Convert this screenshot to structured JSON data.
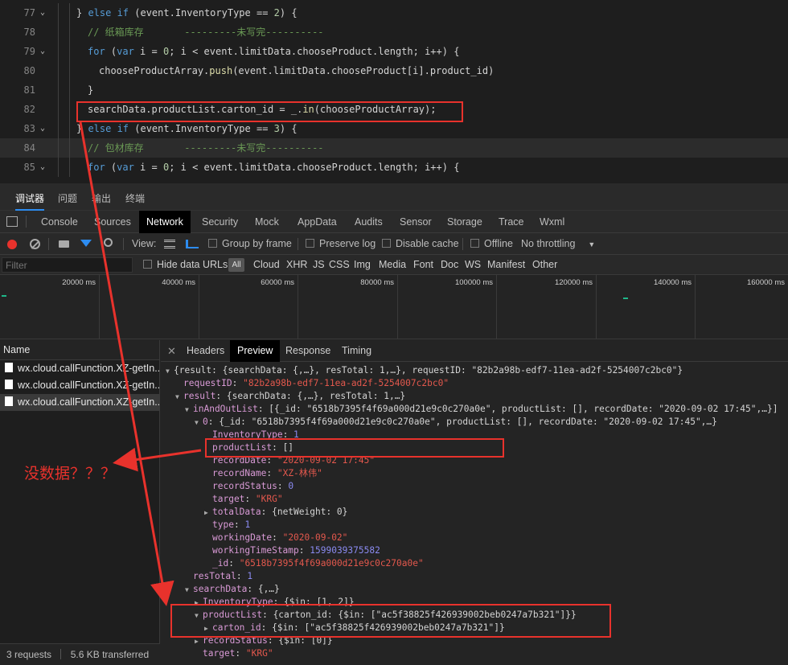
{
  "editor": {
    "lines": [
      {
        "num": "77",
        "fold": "⌄",
        "indent": 95,
        "tokens": [
          [
            "pl",
            "} "
          ],
          [
            "kw",
            "else if"
          ],
          [
            "pl",
            " (event.InventoryType == "
          ],
          [
            "num",
            "2"
          ],
          [
            "pl",
            ") {"
          ]
        ]
      },
      {
        "num": "78",
        "fold": "",
        "indent": 109,
        "tokens": [
          [
            "cm",
            "// 纸箱库存       ---------未写完----------"
          ]
        ]
      },
      {
        "num": "79",
        "fold": "⌄",
        "indent": 109,
        "tokens": [
          [
            "kw",
            "for"
          ],
          [
            "pl",
            " ("
          ],
          [
            "kw",
            "var"
          ],
          [
            "pl",
            " i = "
          ],
          [
            "num",
            "0"
          ],
          [
            "pl",
            "; i < event.limitData.chooseProduct.length; i++) {"
          ]
        ]
      },
      {
        "num": "80",
        "fold": "",
        "indent": 123,
        "tokens": [
          [
            "pl",
            "chooseProductArray."
          ],
          [
            "fn",
            "push"
          ],
          [
            "pl",
            "(event.limitData.chooseProduct[i].product_id)"
          ]
        ]
      },
      {
        "num": "81",
        "fold": "",
        "indent": 109,
        "tokens": [
          [
            "pl",
            "}"
          ]
        ]
      },
      {
        "num": "82",
        "fold": "",
        "indent": 109,
        "tokens": [
          [
            "pl",
            "searchData.productList.carton_id = _."
          ],
          [
            "fn",
            "in"
          ],
          [
            "pl",
            "(chooseProductArray);"
          ]
        ]
      },
      {
        "num": "83",
        "fold": "⌄",
        "indent": 95,
        "tokens": [
          [
            "pl",
            "} "
          ],
          [
            "kw",
            "else if"
          ],
          [
            "pl",
            " (event.InventoryType == "
          ],
          [
            "num",
            "3"
          ],
          [
            "pl",
            ") {"
          ]
        ]
      },
      {
        "num": "84",
        "fold": "",
        "indent": 109,
        "tokens": [
          [
            "cm",
            "// 包材库存       ---------未写完----------"
          ]
        ]
      },
      {
        "num": "85",
        "fold": "⌄",
        "indent": 109,
        "tokens": [
          [
            "kw",
            "for"
          ],
          [
            "pl",
            " ("
          ],
          [
            "kw",
            "var"
          ],
          [
            "pl",
            " i = "
          ],
          [
            "num",
            "0"
          ],
          [
            "pl",
            "; i < event.limitData.chooseProduct.length; i++) {"
          ]
        ]
      }
    ]
  },
  "devtools": {
    "top_tabs": [
      "调试器",
      "问题",
      "输出",
      "终端"
    ],
    "panel_tabs": [
      "Console",
      "Sources",
      "Network",
      "Security",
      "Mock",
      "AppData",
      "Audits",
      "Sensor",
      "Storage",
      "Trace",
      "Wxml"
    ],
    "toolbar": {
      "view_label": "View:",
      "group_by_frame": "Group by frame",
      "preserve_log": "Preserve log",
      "disable_cache": "Disable cache",
      "offline": "Offline",
      "throttling": "No throttling"
    },
    "filter": {
      "placeholder": "Filter",
      "hide_data_urls": "Hide data URLs",
      "all": "All",
      "types": [
        "Cloud",
        "XHR",
        "JS",
        "CSS",
        "Img",
        "Media",
        "Font",
        "Doc",
        "WS",
        "Manifest",
        "Other"
      ]
    },
    "timeline_labels": [
      "20000 ms",
      "40000 ms",
      "60000 ms",
      "80000 ms",
      "100000 ms",
      "120000 ms",
      "140000 ms",
      "160000 ms"
    ],
    "name_header": "Name",
    "requests": [
      "wx.cloud.callFunction.XZ-getIn...",
      "wx.cloud.callFunction.XZ-getIn...",
      "wx.cloud.callFunction.XZ-getIn..."
    ],
    "status": {
      "requests": "3 requests",
      "transferred": "5.6 KB transferred"
    },
    "detail_tabs": [
      "Headers",
      "Preview",
      "Response",
      "Timing"
    ],
    "preview_lines": [
      {
        "indent": 0,
        "tri": "▼",
        "parts": [
          [
            "dim",
            "{result: {searchData: {,…}, resTotal: 1,…}, requestID: \"82b2a98b-edf7-11ea-ad2f-5254007c2bc0\"}"
          ]
        ]
      },
      {
        "indent": 1,
        "tri": "",
        "parts": [
          [
            "k",
            "requestID"
          ],
          [
            "dim",
            ": "
          ],
          [
            "s",
            "\"82b2a98b-edf7-11ea-ad2f-5254007c2bc0\""
          ]
        ]
      },
      {
        "indent": 1,
        "tri": "▼",
        "parts": [
          [
            "k",
            "result"
          ],
          [
            "dim",
            ": {searchData: {,…}, resTotal: 1,…}"
          ]
        ]
      },
      {
        "indent": 2,
        "tri": "▼",
        "parts": [
          [
            "k",
            "inAndOutList"
          ],
          [
            "dim",
            ": [{_id: \"6518b7395f4f69a000d21e9c0c270a0e\", productList: [], recordDate: \"2020-09-02 17:45\",…}]"
          ]
        ]
      },
      {
        "indent": 3,
        "tri": "▼",
        "parts": [
          [
            "k",
            "0"
          ],
          [
            "dim",
            ": {_id: \"6518b7395f4f69a000d21e9c0c270a0e\", productList: [], recordDate: \"2020-09-02 17:45\",…}"
          ]
        ]
      },
      {
        "indent": 4,
        "tri": "",
        "parts": [
          [
            "k",
            "InventoryType"
          ],
          [
            "dim",
            ": "
          ],
          [
            "n",
            "1"
          ]
        ]
      },
      {
        "indent": 4,
        "tri": "",
        "parts": [
          [
            "k",
            "productList"
          ],
          [
            "dim",
            ": []"
          ]
        ]
      },
      {
        "indent": 4,
        "tri": "",
        "parts": [
          [
            "k",
            "recordDate"
          ],
          [
            "dim",
            ": "
          ],
          [
            "s",
            "\"2020-09-02 17:45\""
          ]
        ]
      },
      {
        "indent": 4,
        "tri": "",
        "parts": [
          [
            "k",
            "recordName"
          ],
          [
            "dim",
            ": "
          ],
          [
            "s",
            "\"XZ-林伟\""
          ]
        ]
      },
      {
        "indent": 4,
        "tri": "",
        "parts": [
          [
            "k",
            "recordStatus"
          ],
          [
            "dim",
            ": "
          ],
          [
            "n",
            "0"
          ]
        ]
      },
      {
        "indent": 4,
        "tri": "",
        "parts": [
          [
            "k",
            "target"
          ],
          [
            "dim",
            ": "
          ],
          [
            "s",
            "\"KRG\""
          ]
        ]
      },
      {
        "indent": 4,
        "tri": "▶",
        "parts": [
          [
            "k",
            "totalData"
          ],
          [
            "dim",
            ": {netWeight: 0}"
          ]
        ]
      },
      {
        "indent": 4,
        "tri": "",
        "parts": [
          [
            "k",
            "type"
          ],
          [
            "dim",
            ": "
          ],
          [
            "n",
            "1"
          ]
        ]
      },
      {
        "indent": 4,
        "tri": "",
        "parts": [
          [
            "k",
            "workingDate"
          ],
          [
            "dim",
            ": "
          ],
          [
            "s",
            "\"2020-09-02\""
          ]
        ]
      },
      {
        "indent": 4,
        "tri": "",
        "parts": [
          [
            "k",
            "workingTimeStamp"
          ],
          [
            "dim",
            ": "
          ],
          [
            "n",
            "1599039375582"
          ]
        ]
      },
      {
        "indent": 4,
        "tri": "",
        "parts": [
          [
            "k",
            "_id"
          ],
          [
            "dim",
            ": "
          ],
          [
            "s",
            "\"6518b7395f4f69a000d21e9c0c270a0e\""
          ]
        ]
      },
      {
        "indent": 2,
        "tri": "",
        "parts": [
          [
            "k",
            "resTotal"
          ],
          [
            "dim",
            ": "
          ],
          [
            "n",
            "1"
          ]
        ]
      },
      {
        "indent": 2,
        "tri": "▼",
        "parts": [
          [
            "k",
            "searchData"
          ],
          [
            "dim",
            ": {,…}"
          ]
        ]
      },
      {
        "indent": 3,
        "tri": "▶",
        "parts": [
          [
            "k",
            "InventoryType"
          ],
          [
            "dim",
            ": {$in: [1, 2]}"
          ]
        ]
      },
      {
        "indent": 3,
        "tri": "▼",
        "parts": [
          [
            "k",
            "productList"
          ],
          [
            "dim",
            ": {carton_id: {$in: [\"ac5f38825f426939002beb0247a7b321\"]}}"
          ]
        ]
      },
      {
        "indent": 4,
        "tri": "▶",
        "parts": [
          [
            "k",
            "carton_id"
          ],
          [
            "dim",
            ": {$in: [\"ac5f38825f426939002beb0247a7b321\"]}"
          ]
        ]
      },
      {
        "indent": 3,
        "tri": "▶",
        "parts": [
          [
            "k",
            "recordStatus"
          ],
          [
            "dim",
            ": {$in: [0]}"
          ]
        ]
      },
      {
        "indent": 3,
        "tri": "",
        "parts": [
          [
            "k",
            "target"
          ],
          [
            "dim",
            ": "
          ],
          [
            "s",
            "\"KRG\""
          ]
        ]
      }
    ]
  },
  "annotation": {
    "text": "没数据？？？",
    "color": "#e8322c"
  }
}
